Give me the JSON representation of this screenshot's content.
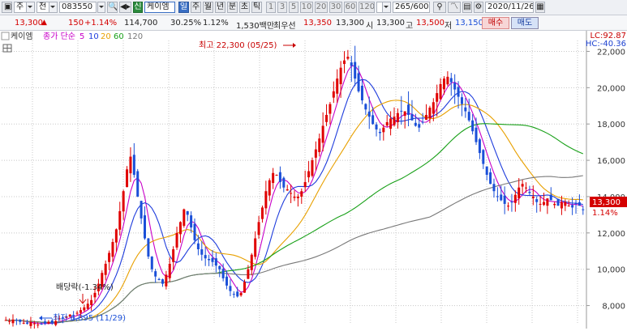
{
  "toolbar": {
    "view_mode": "주",
    "market": "전",
    "code": "083550",
    "tag": "신",
    "name": "케이엠",
    "periods": [
      "일",
      "주",
      "월",
      "년",
      "분",
      "초",
      "틱"
    ],
    "minutes": [
      "1",
      "3",
      "5",
      "10",
      "20",
      "30",
      "60",
      "120"
    ],
    "count": "265/600",
    "date": "2020/11/26"
  },
  "quote": {
    "price": "13,300",
    "change": "150",
    "change_pct": "+1.14%",
    "volume": "114,700",
    "volume_ratio": "30.25%",
    "turnover_pct": "1.12%",
    "amount": "1,530백만",
    "best_bid_label": "최우선",
    "best_bid": "13,350",
    "best_ask": "13,300",
    "open_label": "시",
    "open": "13,300",
    "high_label": "고",
    "high": "13,500",
    "low_label": "저",
    "low": "13,150",
    "buy_label": "매수",
    "sell_label": "매도"
  },
  "legend": {
    "stock": "케이엠",
    "ma_label": "종가 단순",
    "periods": [
      "5",
      "10",
      "20",
      "60",
      "120"
    ],
    "colors": [
      "#c800c8",
      "#1e3cdc",
      "#e8a000",
      "#18a018",
      "#787878"
    ]
  },
  "annotations": {
    "high_text": "최고 22,300 (05/25)",
    "low_text": "최저 6,895 (11/29)",
    "dividend_text": "배당락(-1.34%)",
    "lc_text": "LC:92.87",
    "hc_text": "HC:-40.36",
    "last_price": "13,300",
    "last_pct": "1.14%"
  },
  "colors": {
    "up": "#e00000",
    "down": "#1a4fd8",
    "grid": "#c8c8c8"
  },
  "chart_data": {
    "type": "candlestick",
    "title": "",
    "xlabel": "",
    "ylabel": "",
    "ylim": [
      7000,
      22600
    ],
    "yticks": [
      8000,
      10000,
      12000,
      14000,
      16000,
      18000,
      20000,
      22000
    ],
    "ytick_labels": [
      "8,000",
      "10,000",
      "12,000",
      "14,000",
      "16,000",
      "18,000",
      "20,000",
      "22,000"
    ],
    "grid": true,
    "close": [
      7200,
      7150,
      7230,
      7180,
      7100,
      7050,
      7000,
      7080,
      7020,
      6950,
      6990,
      7000,
      7100,
      7050,
      7150,
      7300,
      7280,
      7400,
      7500,
      7450,
      7600,
      7750,
      7900,
      8100,
      8300,
      8700,
      9200,
      9800,
      10300,
      10900,
      11500,
      12200,
      13200,
      14300,
      15500,
      16200,
      15200,
      14000,
      12800,
      11700,
      10700,
      10000,
      9600,
      9400,
      9200,
      9700,
      10300,
      11100,
      12000,
      12600,
      13300,
      13000,
      12300,
      11600,
      11100,
      10800,
      10600,
      10500,
      10400,
      10200,
      10000,
      9500,
      9100,
      8800,
      8600,
      8500,
      8700,
      9300,
      10000,
      10800,
      11700,
      12600,
      13400,
      14300,
      14900,
      15300,
      15200,
      14800,
      14500,
      14400,
      14200,
      14000,
      14000,
      14300,
      14800,
      15400,
      16000,
      16600,
      17200,
      17900,
      18500,
      19100,
      19800,
      20500,
      21100,
      21500,
      21700,
      21200,
      20500,
      19800,
      19300,
      18800,
      18400,
      18000,
      17700,
      17500,
      17800,
      18100,
      18300,
      18400,
      18600,
      18700,
      18700,
      18500,
      18200,
      17900,
      17800,
      18100,
      18500,
      18900,
      19200,
      19700,
      20200,
      20500,
      20600,
      20300,
      19900,
      19500,
      19100,
      18700,
      18200,
      17600,
      17000,
      16400,
      15800,
      15200,
      14700,
      14300,
      14000,
      13800,
      13600,
      13500,
      13700,
      14100,
      14500,
      14700,
      14500,
      14200,
      14000,
      13700,
      13600,
      13700,
      13900,
      13800,
      13600,
      13500,
      13700,
      13700,
      13500,
      13400,
      13600,
      13500,
      13300
    ],
    "candles_note": "weekly candles, red=up, blue=down",
    "ma_periods": [
      5,
      10,
      20,
      60,
      120
    ]
  }
}
